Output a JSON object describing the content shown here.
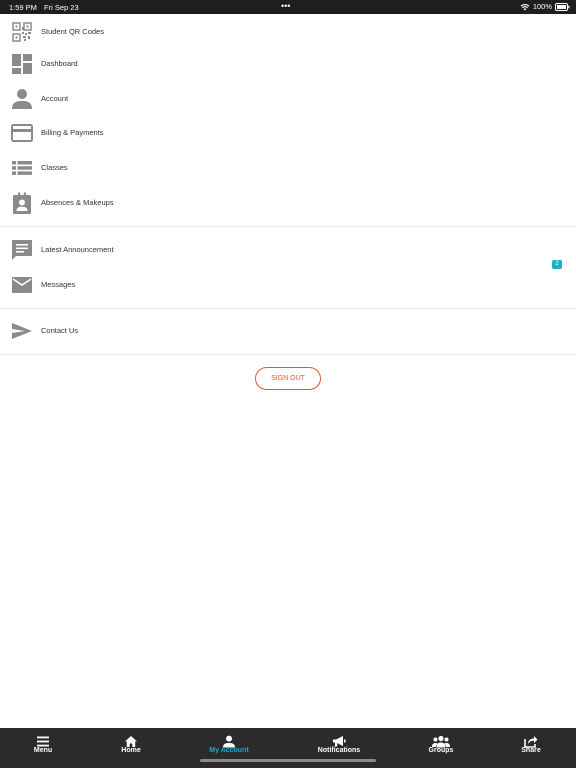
{
  "status_bar": {
    "time": "1:59 PM",
    "date": "Fri Sep 23",
    "dots": "•••",
    "battery": "100%"
  },
  "menu": {
    "items": [
      {
        "label": "Student QR Codes",
        "icon": "qr-code-icon"
      },
      {
        "label": "Dashboard",
        "icon": "dashboard-icon"
      },
      {
        "label": "Account",
        "icon": "person-icon"
      },
      {
        "label": "Billing & Payments",
        "icon": "credit-card-icon"
      },
      {
        "label": "Classes",
        "icon": "list-icon"
      },
      {
        "label": "Absences & Makeups",
        "icon": "clipboard-user-icon"
      },
      {
        "label": "Latest Announcement",
        "icon": "announcement-icon"
      },
      {
        "label": "Messages",
        "icon": "envelope-icon",
        "badge": "2"
      },
      {
        "label": "Contact Us",
        "icon": "send-icon"
      }
    ]
  },
  "signout_label": "SIGN OUT",
  "tabbar": {
    "tabs": [
      {
        "label": "Menu",
        "icon": "hamburger-icon",
        "active": false
      },
      {
        "label": "Home",
        "icon": "home-icon",
        "active": false
      },
      {
        "label": "My Account",
        "icon": "person-icon",
        "active": true
      },
      {
        "label": "Notifications",
        "icon": "megaphone-icon",
        "active": false
      },
      {
        "label": "Groups",
        "icon": "group-icon",
        "active": false
      },
      {
        "label": "Share",
        "icon": "share-icon",
        "active": false
      }
    ]
  },
  "colors": {
    "accent": "#1aa9d6",
    "badge": "#17b3c6",
    "signout": "#e0573f",
    "icon": "#8a8a8a",
    "tabbar_bg": "#2b2b2b"
  }
}
